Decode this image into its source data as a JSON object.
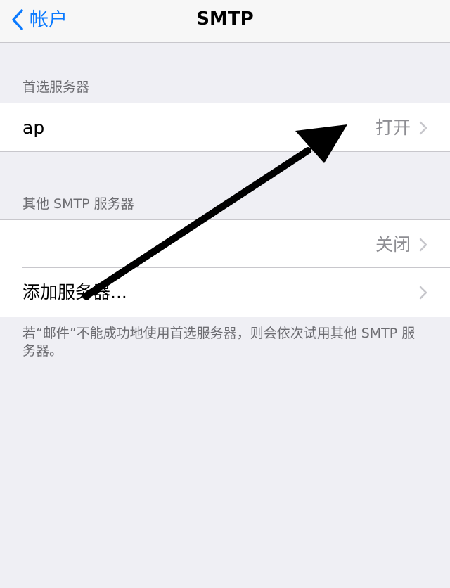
{
  "nav": {
    "back_label": "帐户",
    "title": "SMTP"
  },
  "primary_section": {
    "header": "首选服务器",
    "row": {
      "label": "ap",
      "value": "打开"
    }
  },
  "other_section": {
    "header": "其他 SMTP 服务器",
    "rows": [
      {
        "label": "",
        "value": "关闭"
      },
      {
        "label": "添加服务器...",
        "value": ""
      }
    ],
    "footer": "若“邮件”不能成功地使用首选服务器，则会依次试用其他 SMTP 服务器。"
  },
  "colors": {
    "accent": "#0a7aff",
    "background": "#efeff4",
    "secondary_text": "#8e8e93",
    "header_text": "#6d6d72",
    "annotation_arrow": "#000000"
  },
  "icons": {
    "back": "chevron-left-icon",
    "disclosure": "chevron-right-icon",
    "annotation": "arrow-annotation"
  }
}
